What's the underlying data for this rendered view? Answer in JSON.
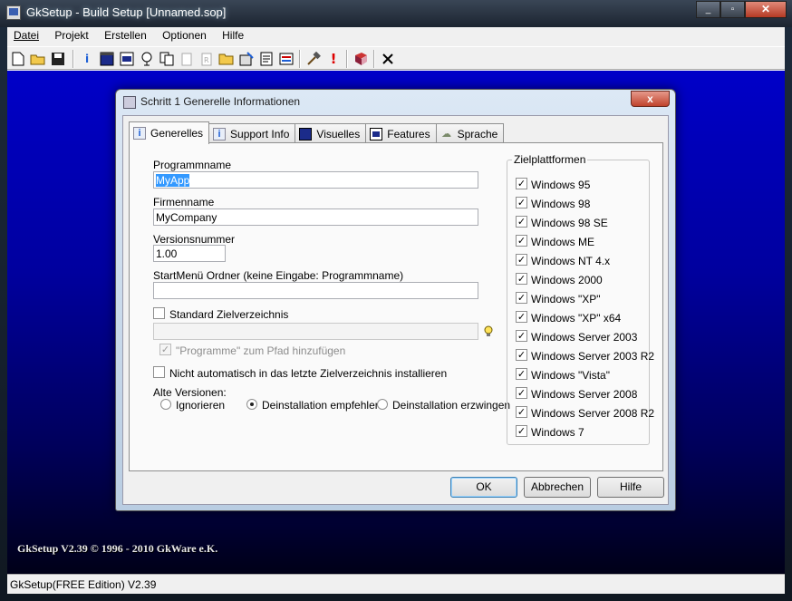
{
  "window": {
    "title": "GkSetup - Build Setup [Unnamed.sop]",
    "caption_min": "_",
    "caption_max": "▫",
    "caption_close": "✕"
  },
  "menu": [
    "Datei",
    "Projekt",
    "Erstellen",
    "Optionen",
    "Hilfe"
  ],
  "toolbar": {
    "icons": [
      "new-icon",
      "open-icon",
      "save-icon",
      "info-icon",
      "window-icon",
      "dialog-icon",
      "features-icon",
      "copy-icon",
      "clipboard-icon",
      "registry-icon",
      "folder-icon",
      "wizard-icon",
      "script-icon",
      "uninstall-icon",
      "build-icon",
      "warning-icon",
      "help-book-icon",
      "close-icon"
    ]
  },
  "workspace": {
    "copyright": "GkSetup V2.39 © 1996 - 2010 GkWare e.K."
  },
  "statusbar": {
    "text": "GkSetup(FREE Edition) V2.39"
  },
  "dialog": {
    "title": "Schritt 1 Generelle Informationen",
    "close": "x",
    "tabs": [
      {
        "label": "Generelles",
        "icon": "i"
      },
      {
        "label": "Support Info",
        "icon": "i"
      },
      {
        "label": "Visuelles",
        "icon": ""
      },
      {
        "label": "Features",
        "icon": ""
      },
      {
        "label": "Sprache",
        "icon": "☁"
      }
    ],
    "fields": {
      "programmname_label": "Programmname",
      "programmname_value": "MyApp",
      "firmenname_label": "Firmenname",
      "firmenname_value": "MyCompany",
      "versionsnummer_label": "Versionsnummer",
      "versionsnummer_value": "1.00",
      "startmenu_label": "StartMenü Ordner (keine Eingabe: Programmname)",
      "startmenu_value": "",
      "standard_ziel_label": "Standard Zielverzeichnis",
      "zielpfad_value": "",
      "programme_pfad_label": "\"Programme\" zum Pfad hinzufügen",
      "nicht_automatisch_label": "Nicht automatisch in das letzte Zielverzeichnis installieren",
      "alte_versionen_label": "Alte Versionen:",
      "radio_ignorieren": "Ignorieren",
      "radio_deinst_empfehlen": "Deinstallation empfehlen",
      "radio_deinst_erzwingen": "Deinstallation erzwingen"
    },
    "platforms": {
      "title": "Zielplattformen",
      "items": [
        "Windows 95",
        "Windows 98",
        "Windows 98 SE",
        "Windows ME",
        "Windows NT 4.x",
        "Windows 2000",
        "Windows \"XP\"",
        "Windows \"XP\" x64",
        "Windows Server 2003",
        "Windows Server 2003 R2",
        "Windows \"Vista\"",
        "Windows Server 2008",
        "Windows Server 2008 R2",
        "Windows 7"
      ]
    },
    "buttons": {
      "ok": "OK",
      "cancel": "Abbrechen",
      "help": "Hilfe"
    }
  }
}
